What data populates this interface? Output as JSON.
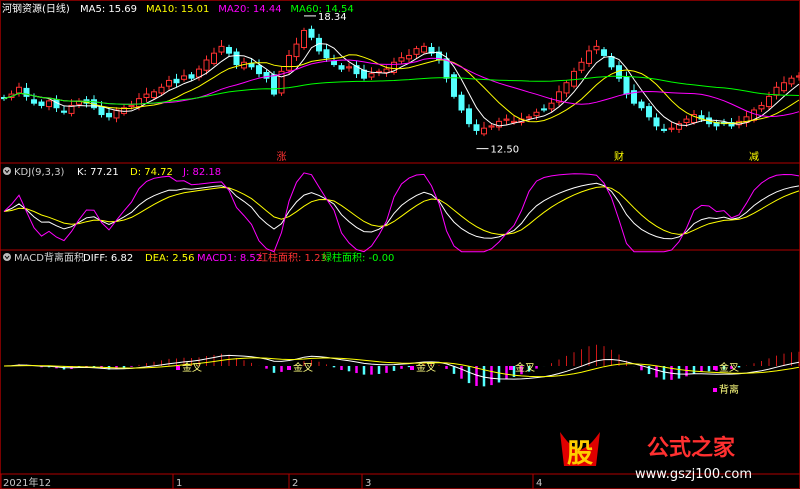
{
  "header": {
    "title": "河钢资源(日线)",
    "ma_labels": [
      {
        "text": "MA5: 15.69",
        "color": "#ffffff"
      },
      {
        "text": "MA10: 15.01",
        "color": "#ffff00"
      },
      {
        "text": "MA20: 14.44",
        "color": "#ff00ff"
      },
      {
        "text": "MA60: 14.54",
        "color": "#00ff00"
      }
    ]
  },
  "colors": {
    "up": "#ff3232",
    "down": "#54ffff",
    "white": "#ffffff",
    "yellow": "#ffff00",
    "magenta": "#ff00ff",
    "green": "#00ff00",
    "grid": "#7a0000"
  },
  "icons": {
    "collapse": "chevron-circle-icon"
  },
  "kdj": {
    "title": "KDJ(9,3,3)",
    "k": "K: 77.21",
    "d": "D: 74.72",
    "j": "J: 82.18"
  },
  "macd": {
    "title": "MACD背离面积",
    "diff": "DIFF: 6.82",
    "dea": "DEA: 2.56",
    "macd1": "MACD1: 8.52",
    "red_area": "红柱面积: 1.23",
    "green_area": "绿柱面积: -0.00",
    "annotations": [
      "金叉",
      "金叉",
      "金叉",
      "金叉",
      "金叉",
      "背离"
    ]
  },
  "price_marks": {
    "high": "18.34",
    "low": "12.50"
  },
  "event_labels": [
    "涨",
    "财",
    "减"
  ],
  "x_axis": {
    "ticks": [
      "2021年12",
      "1",
      "2",
      "3",
      "4"
    ]
  },
  "watermark": {
    "logo_char": "股",
    "brand": "公式之家",
    "url": "www.gszj100.com"
  },
  "chart_data": [
    {
      "type": "candlestick",
      "title": "河钢资源(日线)",
      "series_names": [
        "MA5",
        "MA10",
        "MA20",
        "MA60"
      ],
      "latest": {
        "MA5": 15.69,
        "MA10": 15.01,
        "MA20": 14.44,
        "MA60": 14.54
      },
      "high_mark": 18.34,
      "low_mark": 12.5,
      "close": [
        14.7,
        14.9,
        15.2,
        14.8,
        14.5,
        14.4,
        14.6,
        14.3,
        14.1,
        14.4,
        14.6,
        14.5,
        14.3,
        14.0,
        13.9,
        14.2,
        14.3,
        14.4,
        14.7,
        14.9,
        15.0,
        15.2,
        15.5,
        15.4,
        15.7,
        15.6,
        16.0,
        16.4,
        16.7,
        17.0,
        16.7,
        16.2,
        16.3,
        16.1,
        15.8,
        15.6,
        14.9,
        15.9,
        16.6,
        17.1,
        17.7,
        17.4,
        16.8,
        16.5,
        16.2,
        16.0,
        16.1,
        15.8,
        15.6,
        15.8,
        15.9,
        16.0,
        16.3,
        16.5,
        16.6,
        16.9,
        17.0,
        16.7,
        16.4,
        15.6,
        14.8,
        14.2,
        13.6,
        13.3,
        13.4,
        13.5,
        13.7,
        13.8,
        13.7,
        13.8,
        13.9,
        14.1,
        14.2,
        14.5,
        15.0,
        15.4,
        15.9,
        16.3,
        16.8,
        17.0,
        16.6,
        16.1,
        15.6,
        14.9,
        14.5,
        14.3,
        13.9,
        13.5,
        13.3,
        13.4,
        13.6,
        13.8,
        14.0,
        13.8,
        13.6,
        13.5,
        13.6,
        13.5,
        13.7,
        13.9,
        14.2,
        14.4,
        14.8,
        15.2,
        15.4,
        15.6,
        15.7
      ]
    },
    {
      "type": "line",
      "title": "KDJ(9,3,3)",
      "series_names": [
        "K",
        "D",
        "J"
      ],
      "latest": {
        "K": 77.21,
        "D": 74.72,
        "J": 82.18
      }
    },
    {
      "type": "bar",
      "title": "MACD背离面积",
      "series_names": [
        "DIFF",
        "DEA",
        "MACD1"
      ],
      "latest": {
        "DIFF": 6.82,
        "DEA": 2.56,
        "MACD1": 8.52,
        "红柱面积": 1.23,
        "绿柱面积": -0.0
      }
    }
  ]
}
